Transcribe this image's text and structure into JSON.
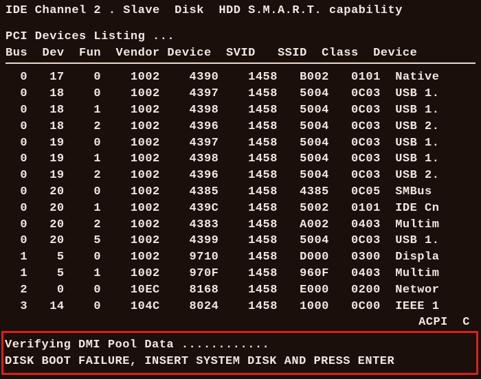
{
  "header": {
    "line": "IDE Channel 2 . Slave  Disk  HDD S.M.A.R.T. capability"
  },
  "listing_title": "PCI Devices Listing ...",
  "columns": {
    "bus": "Bus",
    "dev": "Dev",
    "fun": "Fun",
    "vendor": "Vendor",
    "device": "Device",
    "svid": "SVID",
    "ssid": "SSID",
    "class": "Class",
    "devicename": "Device"
  },
  "rows": [
    {
      "bus": "0",
      "dev": "17",
      "fun": "0",
      "vendor": "1002",
      "device": "4390",
      "svid": "1458",
      "ssid": "B002",
      "class": "0101",
      "name": "Native"
    },
    {
      "bus": "0",
      "dev": "18",
      "fun": "0",
      "vendor": "1002",
      "device": "4397",
      "svid": "1458",
      "ssid": "5004",
      "class": "0C03",
      "name": "USB 1."
    },
    {
      "bus": "0",
      "dev": "18",
      "fun": "1",
      "vendor": "1002",
      "device": "4398",
      "svid": "1458",
      "ssid": "5004",
      "class": "0C03",
      "name": "USB 1."
    },
    {
      "bus": "0",
      "dev": "18",
      "fun": "2",
      "vendor": "1002",
      "device": "4396",
      "svid": "1458",
      "ssid": "5004",
      "class": "0C03",
      "name": "USB 2."
    },
    {
      "bus": "0",
      "dev": "19",
      "fun": "0",
      "vendor": "1002",
      "device": "4397",
      "svid": "1458",
      "ssid": "5004",
      "class": "0C03",
      "name": "USB 1."
    },
    {
      "bus": "0",
      "dev": "19",
      "fun": "1",
      "vendor": "1002",
      "device": "4398",
      "svid": "1458",
      "ssid": "5004",
      "class": "0C03",
      "name": "USB 1."
    },
    {
      "bus": "0",
      "dev": "19",
      "fun": "2",
      "vendor": "1002",
      "device": "4396",
      "svid": "1458",
      "ssid": "5004",
      "class": "0C03",
      "name": "USB 2."
    },
    {
      "bus": "0",
      "dev": "20",
      "fun": "0",
      "vendor": "1002",
      "device": "4385",
      "svid": "1458",
      "ssid": "4385",
      "class": "0C05",
      "name": "SMBus "
    },
    {
      "bus": "0",
      "dev": "20",
      "fun": "1",
      "vendor": "1002",
      "device": "439C",
      "svid": "1458",
      "ssid": "5002",
      "class": "0101",
      "name": "IDE Cn"
    },
    {
      "bus": "0",
      "dev": "20",
      "fun": "2",
      "vendor": "1002",
      "device": "4383",
      "svid": "1458",
      "ssid": "A002",
      "class": "0403",
      "name": "Multim"
    },
    {
      "bus": "0",
      "dev": "20",
      "fun": "5",
      "vendor": "1002",
      "device": "4399",
      "svid": "1458",
      "ssid": "5004",
      "class": "0C03",
      "name": "USB 1."
    },
    {
      "bus": "1",
      "dev": "5",
      "fun": "0",
      "vendor": "1002",
      "device": "9710",
      "svid": "1458",
      "ssid": "D000",
      "class": "0300",
      "name": "Displa"
    },
    {
      "bus": "1",
      "dev": "5",
      "fun": "1",
      "vendor": "1002",
      "device": "970F",
      "svid": "1458",
      "ssid": "960F",
      "class": "0403",
      "name": "Multim"
    },
    {
      "bus": "2",
      "dev": "0",
      "fun": "0",
      "vendor": "10EC",
      "device": "8168",
      "svid": "1458",
      "ssid": "E000",
      "class": "0200",
      "name": "Networ"
    },
    {
      "bus": "3",
      "dev": "14",
      "fun": "0",
      "vendor": "104C",
      "device": "8024",
      "svid": "1458",
      "ssid": "1000",
      "class": "0C00",
      "name": "IEEE 1"
    }
  ],
  "acpi_tail": "ACPI  C",
  "status": {
    "verifying": "Verifying DMI Pool Data ............",
    "error": "DISK BOOT FAILURE, INSERT SYSTEM DISK AND PRESS ENTER"
  }
}
